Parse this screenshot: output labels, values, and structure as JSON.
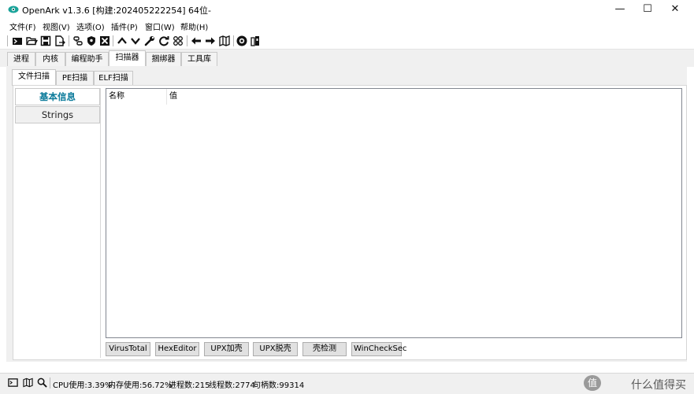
{
  "window": {
    "title": "OpenArk v1.3.6 [构建:202405222254]  64位-",
    "minimize": "—",
    "maximize": "☐",
    "close": "✕"
  },
  "menu": [
    {
      "label": "文件(F)"
    },
    {
      "label": "视图(V)"
    },
    {
      "label": "选项(O)"
    },
    {
      "label": "插件(P)"
    },
    {
      "label": "窗口(W)"
    },
    {
      "label": "帮助(H)"
    }
  ],
  "toolbar_icons": [
    "console-icon",
    "folder-open-icon",
    "save-icon",
    "export-icon",
    "link-icon",
    "shield-icon",
    "kill-icon",
    "chevron-up-icon",
    "chevron-down-icon",
    "wrench-icon",
    "refresh-icon",
    "grid-icon",
    "arrow-left-icon",
    "arrow-right-icon",
    "map-icon",
    "github-icon",
    "bin-icon"
  ],
  "main_tabs": [
    {
      "label": "进程"
    },
    {
      "label": "内核"
    },
    {
      "label": "编程助手"
    },
    {
      "label": "扫描器"
    },
    {
      "label": "捆绑器"
    },
    {
      "label": "工具库"
    }
  ],
  "sub_tabs": [
    {
      "label": "文件扫描"
    },
    {
      "label": "PE扫描"
    },
    {
      "label": "ELF扫描"
    }
  ],
  "left_nav": [
    {
      "label": "基本信息"
    },
    {
      "label": "Strings"
    }
  ],
  "table": {
    "columns": [
      "名称",
      "值"
    ]
  },
  "buttons": [
    {
      "label": "VirusTotal"
    },
    {
      "label": "HexEditor"
    },
    {
      "label": "UPX加壳"
    },
    {
      "label": "UPX脱壳"
    },
    {
      "label": "壳检测"
    },
    {
      "label": "WinCheckSec"
    }
  ],
  "status": {
    "cpu": "CPU使用:3.39%",
    "mem": "内存使用:56.72%",
    "proc": "进程数:215",
    "threads": "线程数:2774",
    "handles": "句柄数:99314"
  },
  "watermark": {
    "badge": "值",
    "text": "什么值得买"
  },
  "colors": {
    "accent": "#0a7a9a"
  }
}
